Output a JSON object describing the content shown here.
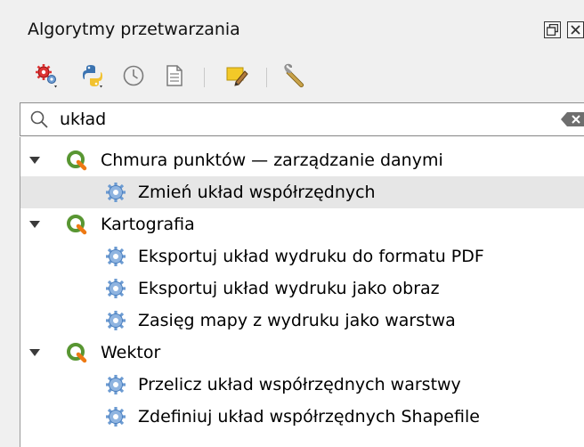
{
  "panel": {
    "title": "Algorytmy przetwarzania",
    "float_icon": "float-icon",
    "close_icon": "close-icon"
  },
  "toolbar": {
    "icons": [
      "models-icon",
      "python-scripts-icon",
      "history-icon",
      "results-icon",
      "edit-features-in-place-icon",
      "options-icon"
    ]
  },
  "search": {
    "value": "układ",
    "icon": "search-icon",
    "clear_icon": "clear-icon"
  },
  "tree": {
    "groups": [
      {
        "label": "Chmura punktów — zarządzanie danymi",
        "items": [
          {
            "label": "Zmień układ współrzędnych",
            "selected": true
          }
        ]
      },
      {
        "label": "Kartografia",
        "items": [
          {
            "label": "Eksportuj układ wydruku do formatu PDF"
          },
          {
            "label": "Eksportuj układ wydruku jako obraz"
          },
          {
            "label": "Zasięg mapy z wydruku jako warstwa"
          }
        ]
      },
      {
        "label": "Wektor",
        "items": [
          {
            "label": "Przelicz układ współrzędnych warstwy"
          },
          {
            "label": "Zdefiniuj układ współrzędnych Shapefile"
          }
        ]
      }
    ]
  },
  "colors": {
    "qgis_green": "#589632",
    "qgis_yellow": "#ee7913",
    "gear_blue": "#6c9bd2",
    "selection": "#e6e6e6"
  }
}
